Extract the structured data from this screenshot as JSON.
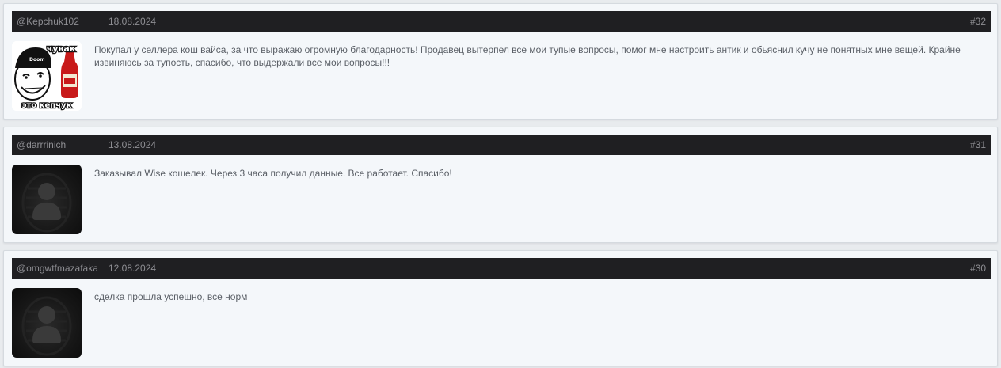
{
  "reviews": [
    {
      "author": "@Kepchuk102",
      "date": "18.08.2024",
      "number": "#32",
      "avatar": "meme-avatar",
      "avatar_caption_top": "чувак",
      "avatar_caption_bottom": "это кепчук",
      "avatar_hat_text": "Doom",
      "text": "Покупал у селлера кош вайса, за что выражаю огромную благодарность! Продавец вытерпел все мои тупые вопросы, помог мне настроить антик и обьяснил кучу не понятных мне вещей. Крайне извиняюсь за тупость, спасибо, что выдержали все мои вопросы!!!"
    },
    {
      "author": "@darrrinich",
      "date": "13.08.2024",
      "number": "#31",
      "avatar": "default-user-avatar",
      "text": "Заказывал Wise кошелек. Через 3 часа получил данные. Все работает. Спасибо!"
    },
    {
      "author": "@omgwtfmazafaka",
      "date": "12.08.2024",
      "number": "#30",
      "avatar": "default-user-avatar",
      "text": "сделка прошла успешно, все норм"
    }
  ]
}
